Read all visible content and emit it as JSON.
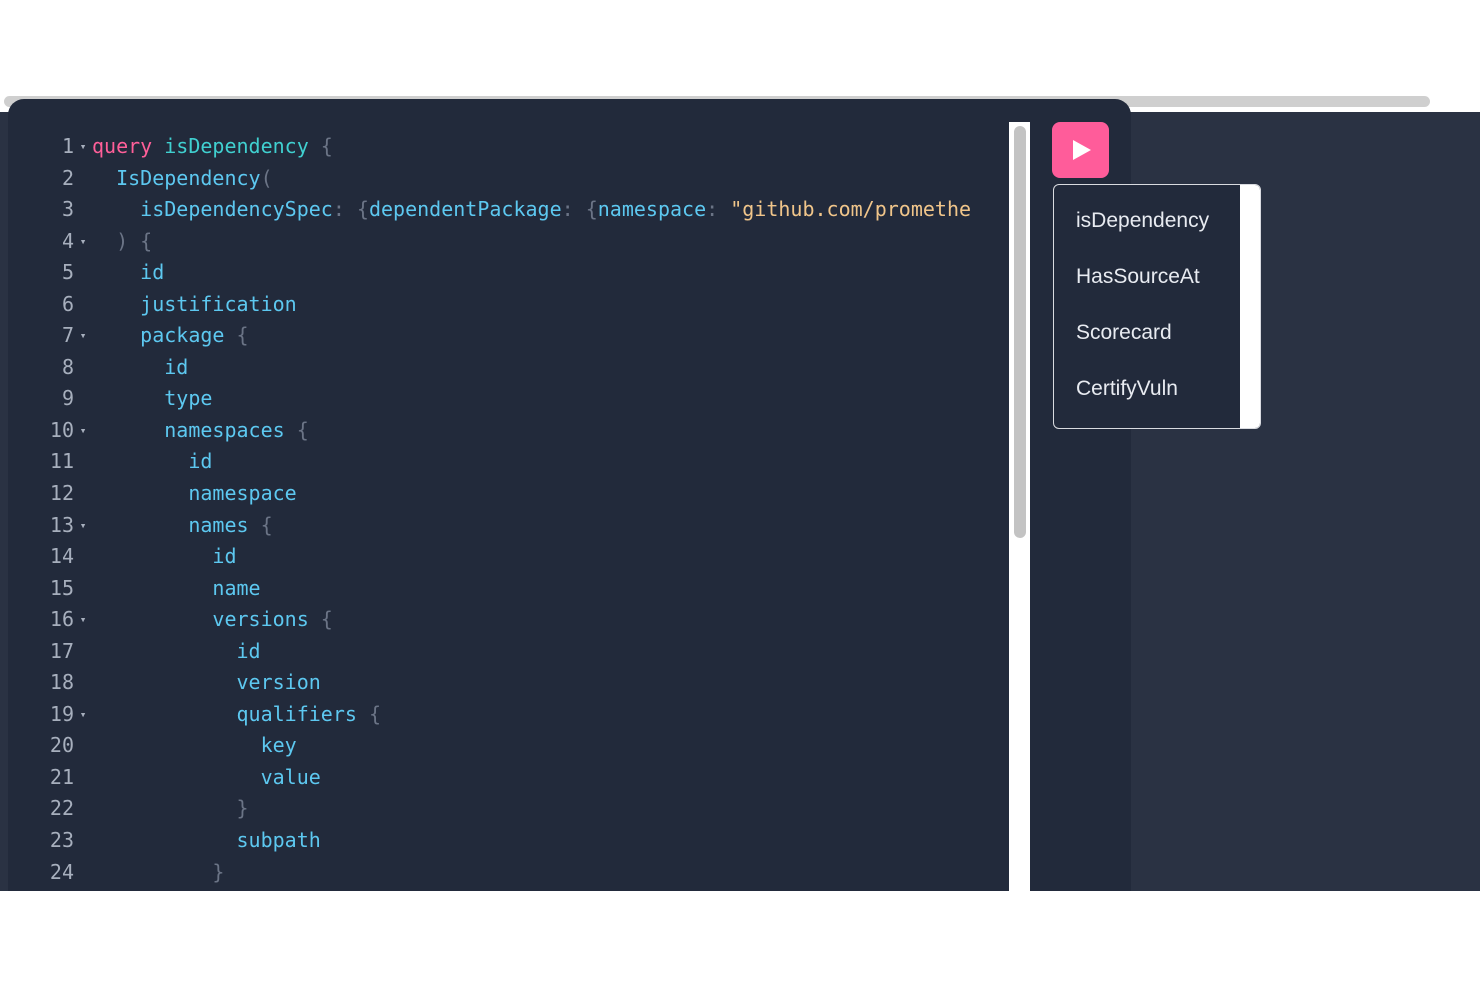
{
  "editor": {
    "lines": [
      {
        "n": "1",
        "fold": true,
        "tokens": [
          {
            "t": "query",
            "c": "kw"
          },
          {
            "t": " ",
            "c": ""
          },
          {
            "t": "isDependency",
            "c": "opn"
          },
          {
            "t": " {",
            "c": "pun"
          }
        ]
      },
      {
        "n": "2",
        "fold": false,
        "tokens": [
          {
            "t": "  ",
            "c": ""
          },
          {
            "t": "IsDependency",
            "c": "fld"
          },
          {
            "t": "(",
            "c": "pun"
          }
        ]
      },
      {
        "n": "3",
        "fold": false,
        "tokens": [
          {
            "t": "    ",
            "c": ""
          },
          {
            "t": "isDependencySpec",
            "c": "attr"
          },
          {
            "t": ": {",
            "c": "pun"
          },
          {
            "t": "dependentPackage",
            "c": "attr"
          },
          {
            "t": ": {",
            "c": "pun"
          },
          {
            "t": "namespace",
            "c": "attr"
          },
          {
            "t": ": ",
            "c": "pun"
          },
          {
            "t": "\"github.com/promethe",
            "c": "str"
          }
        ]
      },
      {
        "n": "4",
        "fold": true,
        "tokens": [
          {
            "t": "  ) {",
            "c": "pun"
          }
        ]
      },
      {
        "n": "5",
        "fold": false,
        "tokens": [
          {
            "t": "    ",
            "c": ""
          },
          {
            "t": "id",
            "c": "fld"
          }
        ]
      },
      {
        "n": "6",
        "fold": false,
        "tokens": [
          {
            "t": "    ",
            "c": ""
          },
          {
            "t": "justification",
            "c": "fld"
          }
        ]
      },
      {
        "n": "7",
        "fold": true,
        "tokens": [
          {
            "t": "    ",
            "c": ""
          },
          {
            "t": "package",
            "c": "fld"
          },
          {
            "t": " {",
            "c": "pun"
          }
        ]
      },
      {
        "n": "8",
        "fold": false,
        "tokens": [
          {
            "t": "      ",
            "c": ""
          },
          {
            "t": "id",
            "c": "fld"
          }
        ]
      },
      {
        "n": "9",
        "fold": false,
        "tokens": [
          {
            "t": "      ",
            "c": ""
          },
          {
            "t": "type",
            "c": "fld"
          }
        ]
      },
      {
        "n": "10",
        "fold": true,
        "tokens": [
          {
            "t": "      ",
            "c": ""
          },
          {
            "t": "namespaces",
            "c": "fld"
          },
          {
            "t": " {",
            "c": "pun"
          }
        ]
      },
      {
        "n": "11",
        "fold": false,
        "tokens": [
          {
            "t": "        ",
            "c": ""
          },
          {
            "t": "id",
            "c": "fld"
          }
        ]
      },
      {
        "n": "12",
        "fold": false,
        "tokens": [
          {
            "t": "        ",
            "c": ""
          },
          {
            "t": "namespace",
            "c": "fld"
          }
        ]
      },
      {
        "n": "13",
        "fold": true,
        "tokens": [
          {
            "t": "        ",
            "c": ""
          },
          {
            "t": "names",
            "c": "fld"
          },
          {
            "t": " {",
            "c": "pun"
          }
        ]
      },
      {
        "n": "14",
        "fold": false,
        "tokens": [
          {
            "t": "          ",
            "c": ""
          },
          {
            "t": "id",
            "c": "fld"
          }
        ]
      },
      {
        "n": "15",
        "fold": false,
        "tokens": [
          {
            "t": "          ",
            "c": ""
          },
          {
            "t": "name",
            "c": "fld"
          }
        ]
      },
      {
        "n": "16",
        "fold": true,
        "tokens": [
          {
            "t": "          ",
            "c": ""
          },
          {
            "t": "versions",
            "c": "fld"
          },
          {
            "t": " {",
            "c": "pun"
          }
        ]
      },
      {
        "n": "17",
        "fold": false,
        "tokens": [
          {
            "t": "            ",
            "c": ""
          },
          {
            "t": "id",
            "c": "fld"
          }
        ]
      },
      {
        "n": "18",
        "fold": false,
        "tokens": [
          {
            "t": "            ",
            "c": ""
          },
          {
            "t": "version",
            "c": "fld"
          }
        ]
      },
      {
        "n": "19",
        "fold": true,
        "tokens": [
          {
            "t": "            ",
            "c": ""
          },
          {
            "t": "qualifiers",
            "c": "fld"
          },
          {
            "t": " {",
            "c": "pun"
          }
        ]
      },
      {
        "n": "20",
        "fold": false,
        "tokens": [
          {
            "t": "              ",
            "c": ""
          },
          {
            "t": "key",
            "c": "fld"
          }
        ]
      },
      {
        "n": "21",
        "fold": false,
        "tokens": [
          {
            "t": "              ",
            "c": ""
          },
          {
            "t": "value",
            "c": "fld"
          }
        ]
      },
      {
        "n": "22",
        "fold": false,
        "tokens": [
          {
            "t": "            }",
            "c": "pun"
          }
        ]
      },
      {
        "n": "23",
        "fold": false,
        "tokens": [
          {
            "t": "            ",
            "c": ""
          },
          {
            "t": "subpath",
            "c": "fld"
          }
        ]
      },
      {
        "n": "24",
        "fold": false,
        "tokens": [
          {
            "t": "          }",
            "c": "pun"
          }
        ]
      }
    ],
    "fold_glyph": "▾"
  },
  "run_button": {
    "icon": "play-icon"
  },
  "operations_menu": {
    "items": [
      "isDependency",
      "HasSourceAt",
      "Scorecard",
      "CertifyVuln"
    ]
  },
  "colors": {
    "editor_bg": "#222a3b",
    "accent": "#ff5c9a",
    "keyword": "#ff5f99",
    "operation_name": "#40d0d0",
    "field": "#5dc8f0",
    "string": "#f0c58a",
    "line_number": "#a7afbd"
  }
}
